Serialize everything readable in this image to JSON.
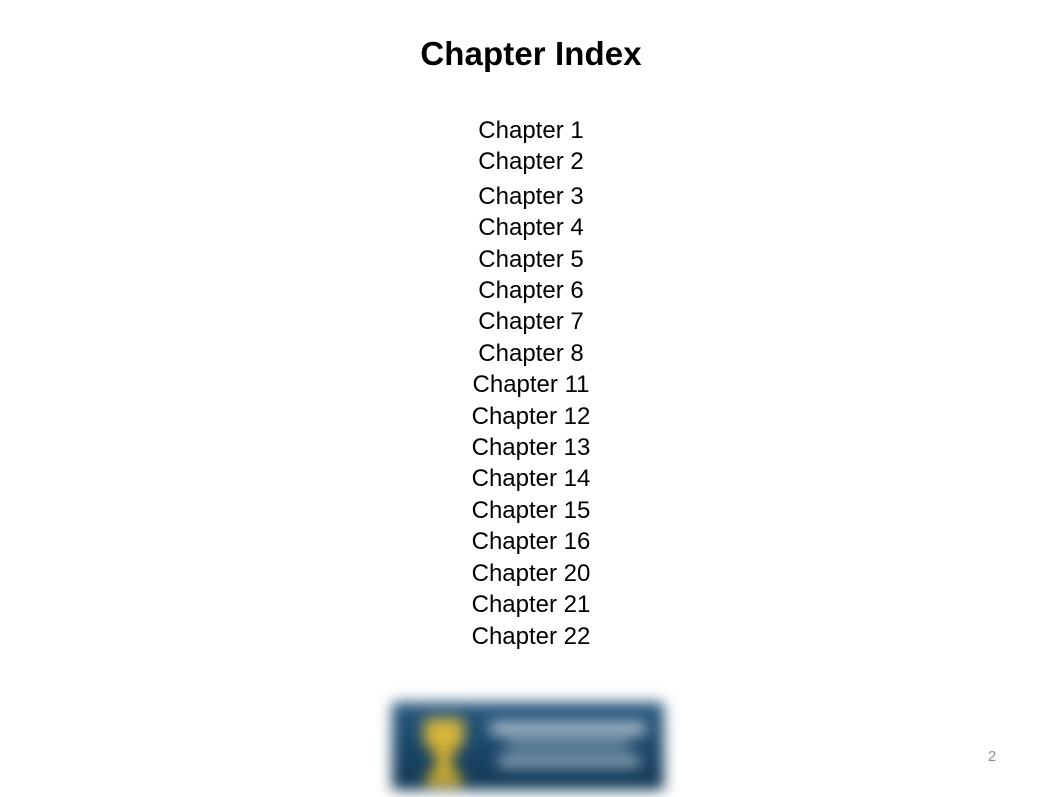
{
  "slide": {
    "title": "Chapter Index",
    "page_number": "2",
    "background_color": "#ffffff",
    "text_color": "#000000",
    "page_number_color": "#919191"
  },
  "chapters": [
    {
      "label": "Chapter 1"
    },
    {
      "label": "Chapter 2"
    },
    {
      "label": "Chapter 3"
    },
    {
      "label": "Chapter 4"
    },
    {
      "label": "Chapter 5"
    },
    {
      "label": "Chapter 6"
    },
    {
      "label": "Chapter 7"
    },
    {
      "label": "Chapter 8"
    },
    {
      "label": "Chapter 11"
    },
    {
      "label": "Chapter 12"
    },
    {
      "label": "Chapter 13"
    },
    {
      "label": "Chapter 14"
    },
    {
      "label": "Chapter 15"
    },
    {
      "label": "Chapter 16"
    },
    {
      "label": "Chapter 20"
    },
    {
      "label": "Chapter 21"
    },
    {
      "label": "Chapter 22"
    }
  ],
  "logo": {
    "name": "university-logo",
    "description": "blurred navy banner logo with gold crest",
    "plate_color": "#1d4466",
    "crest_color": "#d6b53a",
    "text_color": "#cfdce6"
  }
}
